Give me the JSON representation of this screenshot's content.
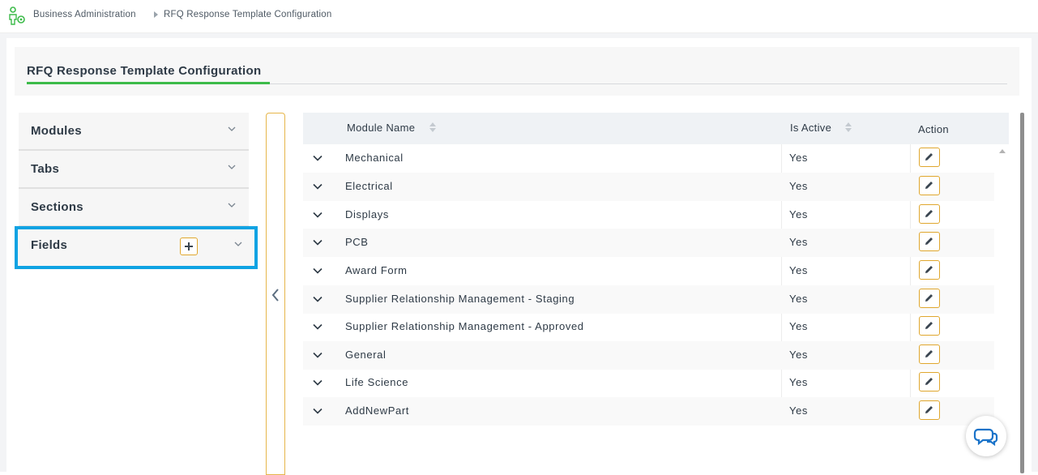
{
  "breadcrumb": {
    "root": "Business Administration",
    "current": "RFQ Response Template Configuration"
  },
  "page": {
    "title": "RFQ Response Template Configuration"
  },
  "accordion": [
    {
      "label": "Modules",
      "has_add": false,
      "selected": false
    },
    {
      "label": "Tabs",
      "has_add": false,
      "selected": false
    },
    {
      "label": "Sections",
      "has_add": false,
      "selected": false
    },
    {
      "label": "Fields",
      "has_add": true,
      "selected": true
    }
  ],
  "grid": {
    "columns": {
      "module_name": "Module Name",
      "is_active": "Is Active",
      "action": "Action"
    },
    "rows": [
      {
        "module_name": "Mechanical",
        "is_active": "Yes"
      },
      {
        "module_name": "Electrical",
        "is_active": "Yes"
      },
      {
        "module_name": "Displays",
        "is_active": "Yes"
      },
      {
        "module_name": "PCB",
        "is_active": "Yes"
      },
      {
        "module_name": "Award Form",
        "is_active": "Yes"
      },
      {
        "module_name": "Supplier Relationship Management - Staging",
        "is_active": "Yes"
      },
      {
        "module_name": "Supplier Relationship Management - Approved",
        "is_active": "Yes"
      },
      {
        "module_name": "General",
        "is_active": "Yes"
      },
      {
        "module_name": "Life Science",
        "is_active": "Yes"
      },
      {
        "module_name": "AddNewPart",
        "is_active": "Yes"
      }
    ]
  },
  "icons": {
    "logo": "business-admin-logo-icon",
    "row_expand": "chevron-down-icon",
    "edit": "pencil-icon",
    "collapse": "chevron-left-icon",
    "add": "plus-icon",
    "chat": "chat-bubbles-icon"
  },
  "colors": {
    "accent_green": "#3dbb4a",
    "highlight_blue": "#10a3e3",
    "button_border": "#e0a72e",
    "chat_blue": "#1a73c9"
  }
}
